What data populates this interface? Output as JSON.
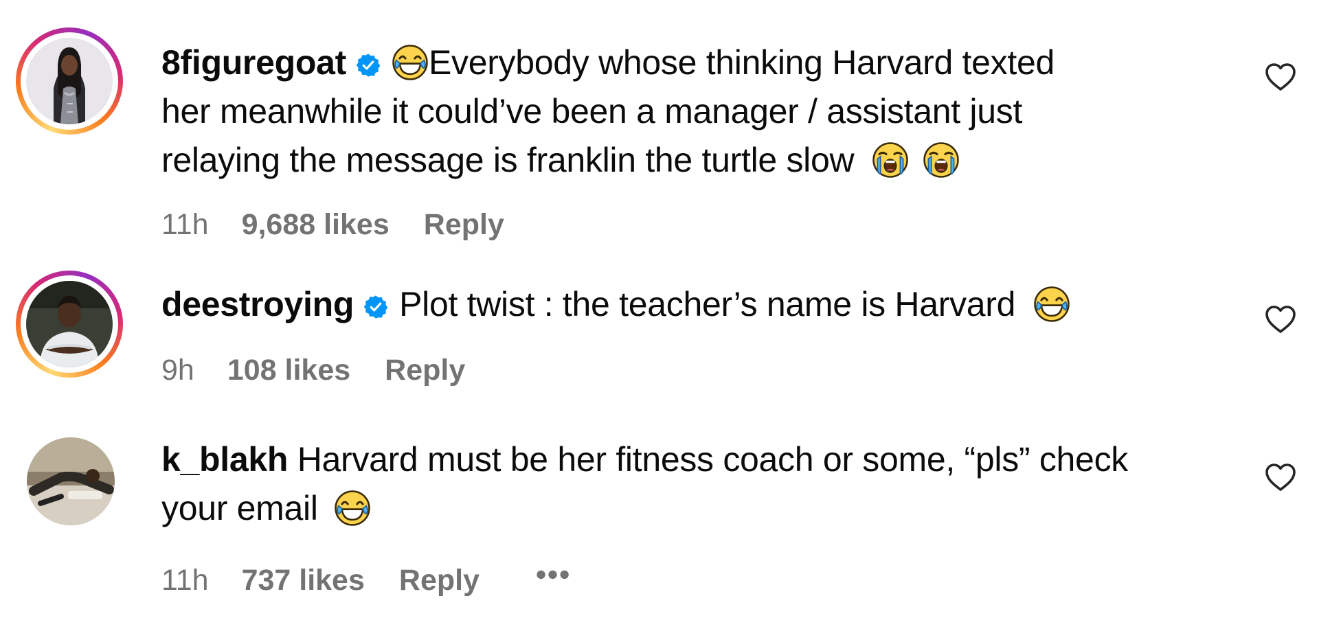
{
  "comments": [
    {
      "username": "8figuregoat",
      "verified": true,
      "avatar": "profile-photo-woman",
      "lines": [
        "Everybody whose thinking Harvard texted",
        "her meanwhile it could’ve been a manager / assistant just",
        "relaying the message is franklin the turtle slow"
      ],
      "time": "11h",
      "likes": "9,688 likes",
      "reply_label": "Reply"
    },
    {
      "username": "deestroying",
      "verified": true,
      "avatar": "profile-photo-man",
      "lines": [
        "Plot twist : the teacher’s name is Harvard"
      ],
      "time": "9h",
      "likes": "108 likes",
      "reply_label": "Reply"
    },
    {
      "username": "k_blakh",
      "verified": false,
      "avatar": "profile-photo-reclining",
      "lines": [
        "Harvard must be her fitness coach or some, “pls” check",
        "your email"
      ],
      "time": "11h",
      "likes": "737 likes",
      "reply_label": "Reply",
      "more_label": "•••"
    }
  ],
  "icons": {
    "verified": "verified-badge-icon",
    "like": "heart-outline-icon",
    "emoji_laugh": "face-with-tears-of-joy-emoji",
    "emoji_cry": "loudly-crying-face-emoji"
  },
  "colors": {
    "verified_blue": "#0095f6",
    "meta_gray": "#737373",
    "text": "#0b0b0b"
  }
}
